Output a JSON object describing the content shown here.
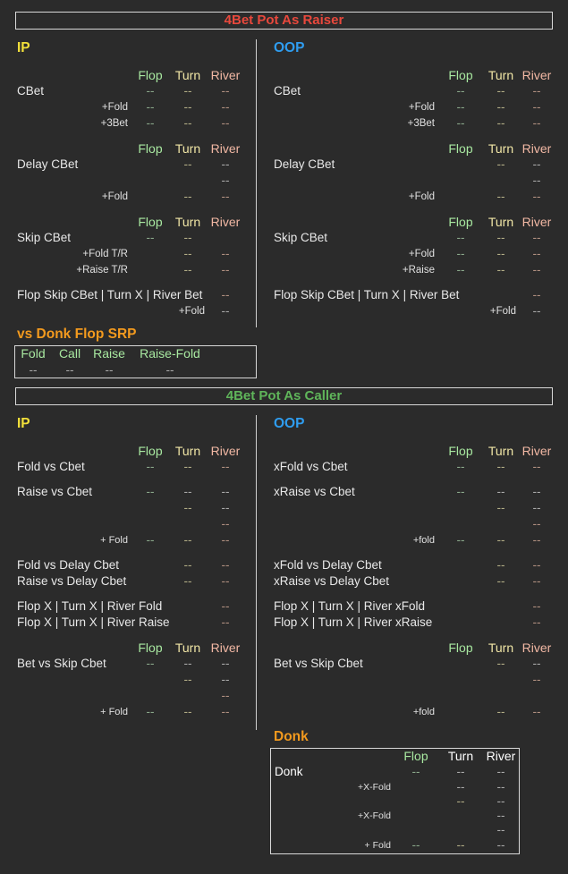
{
  "raiser": {
    "title": "4Bet Pot As Raiser",
    "ip_label": "IP",
    "oop_label": "OOP",
    "hdr": {
      "flop": "Flop",
      "turn": "Turn",
      "river": "River"
    },
    "dash": "--",
    "cbet": "CBet",
    "fold": "+Fold",
    "three_bet": "+3Bet",
    "delay_cbet": "Delay CBet",
    "skip_cbet": "Skip CBet",
    "ip_fold_tr": "+Fold T/R",
    "ip_raise_tr": "+Raise T/R",
    "oop_raise": "+Raise",
    "flop_skip_line": "Flop Skip CBet | Turn X | River Bet",
    "vs_donk_title": "vs Donk Flop SRP",
    "donk_cols": [
      "Fold",
      "Call",
      "Raise",
      "Raise-Fold"
    ]
  },
  "caller": {
    "title": "4Bet Pot As Caller",
    "ip_label": "IP",
    "oop_label": "OOP",
    "ip": {
      "fold_vs_cbet": "Fold vs Cbet",
      "raise_vs_cbet": "Raise vs Cbet",
      "fold_sm": "+ Fold",
      "fold_vs_delay": "Fold vs Delay Cbet",
      "raise_vs_delay": "Raise vs Delay Cbet",
      "river_fold": "Flop X | Turn X | River Fold",
      "river_raise": "Flop X | Turn X | River Raise",
      "bet_vs_skip": "Bet vs Skip Cbet"
    },
    "oop": {
      "fold_vs_cbet": "xFold vs Cbet",
      "raise_vs_cbet": "xRaise vs Cbet",
      "fold_sm": "+fold",
      "fold_vs_delay": "xFold vs Delay Cbet",
      "raise_vs_delay": "xRaise vs Delay Cbet",
      "river_fold": "Flop X | Turn X | River xFold",
      "river_raise": "Flop X | Turn X | River xRaise",
      "bet_vs_skip": "Bet vs Skip Cbet"
    },
    "donk_title": "Donk",
    "donk": "Donk",
    "x_fold": "+X-Fold",
    "plus_fold": "+ Fold"
  }
}
